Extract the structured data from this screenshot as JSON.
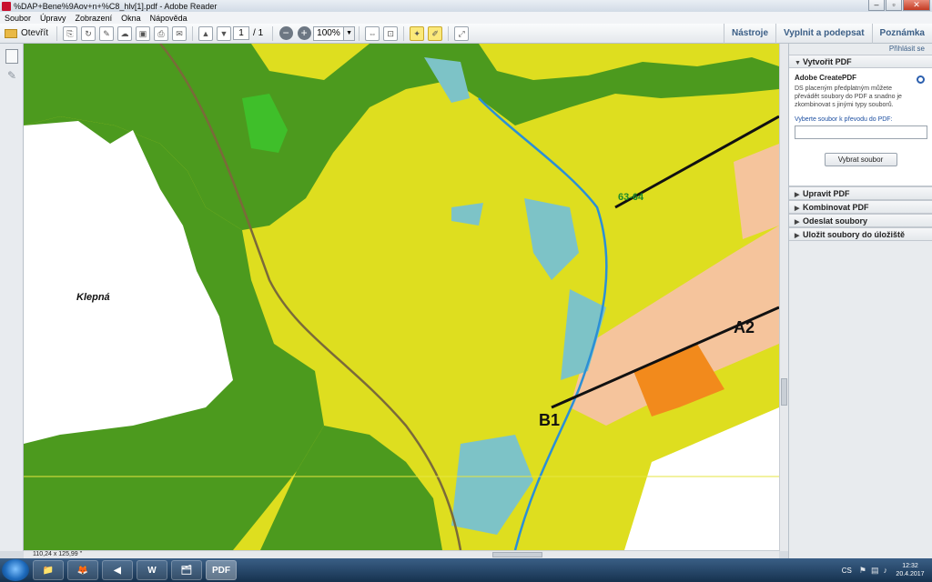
{
  "window": {
    "title": "%DAP+Bene%9Aov+n+%C8_hlv[1].pdf - Adobe Reader",
    "controls": {
      "minimize": "–",
      "maximize": "▫",
      "close": "✕"
    }
  },
  "menubar": [
    "Soubor",
    "Úpravy",
    "Zobrazení",
    "Okna",
    "Nápověda"
  ],
  "toolbar": {
    "open_label": "Otevřít",
    "page_current": "1",
    "page_total": "/ 1",
    "zoom_value": "100%",
    "right_tabs": [
      "Nástroje",
      "Vyplnit a podepsat",
      "Poznámka"
    ]
  },
  "map": {
    "labels": {
      "place": "Klepná",
      "zone_b1": "B1",
      "zone_a2": "A2",
      "zone_6364": "63-64"
    },
    "colors": {
      "forest": "#4c9a1e",
      "meadow": "#dede1f",
      "built": "#f5c49c",
      "industry": "#f28a1c",
      "water": "#7dc3c7",
      "white_area": "#ffffff"
    }
  },
  "statusbar": {
    "dimensions": "110,24 x 125,99 \""
  },
  "rightpanel": {
    "signin": "Přihlásit se",
    "create": {
      "header": "Vytvořit PDF",
      "title": "Adobe CreatePDF",
      "description": "DS placeným předplatným můžete převádět soubory do PDF a snadno je zkombinovat s jinými typy souborů.",
      "select_label": "Vyberte soubor k převodu do PDF:",
      "button": "Vybrat soubor"
    },
    "sections": [
      "Upravit PDF",
      "Kombinovat PDF",
      "Odeslat soubory",
      "Uložit soubory do úložiště"
    ]
  },
  "taskbar": {
    "apps": [
      "📁",
      "🦊",
      "◀",
      "W",
      "🗂",
      "PDF"
    ],
    "language": "CS",
    "time": "12:32",
    "date": "20.4.2017"
  }
}
